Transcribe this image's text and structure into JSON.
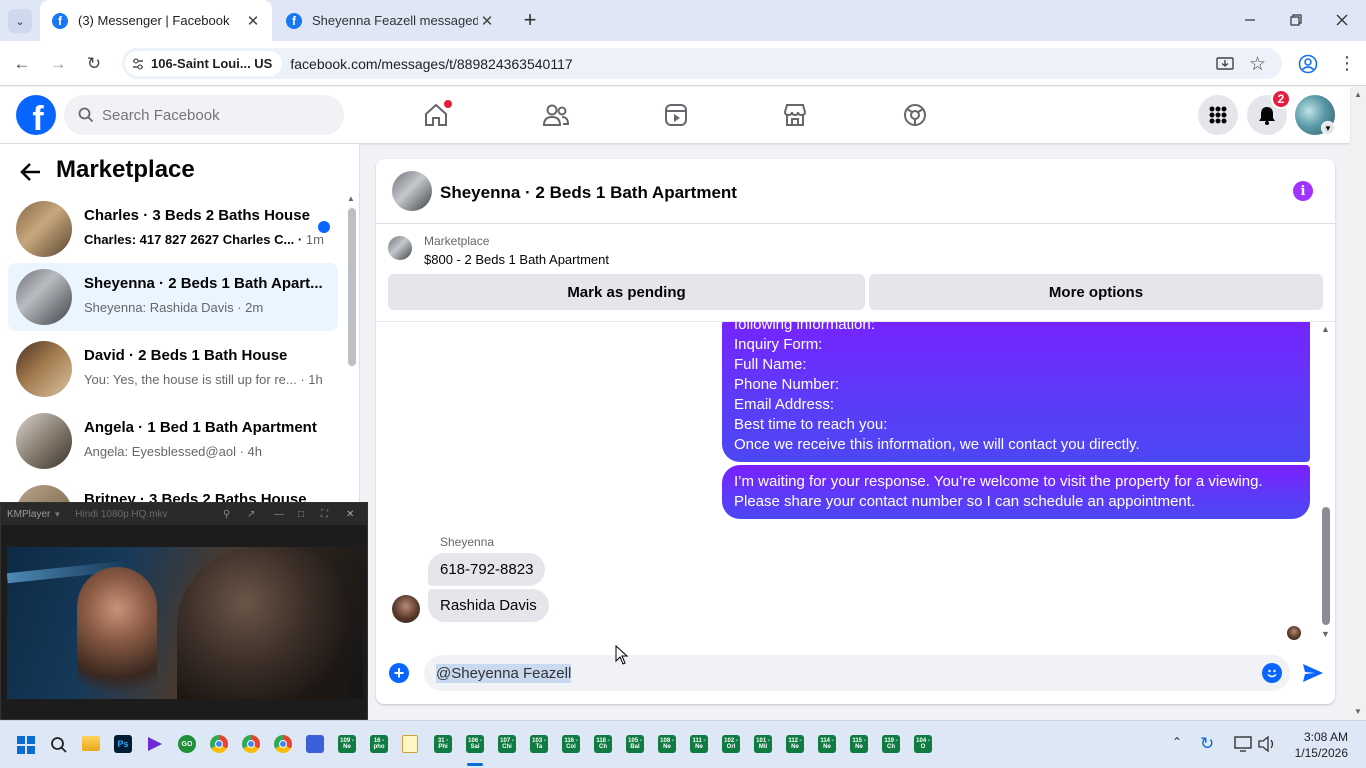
{
  "browser": {
    "tabs": [
      {
        "title": "(3) Messenger | Facebook",
        "active": true
      },
      {
        "title": "Sheyenna Feazell messaged Sheyenna",
        "active": false
      }
    ],
    "location_chip": "106-Saint Loui... US",
    "url": "facebook.com/messages/t/889824363540117"
  },
  "fb": {
    "search_placeholder": "Search Facebook",
    "notifications_badge": "2"
  },
  "sidebar": {
    "title": "Marketplace",
    "conversations": [
      {
        "name": "Charles · 3 Beds 2 Baths House",
        "preview": "Charles: 417 827 2627 Charles C...",
        "time": "1m",
        "unread": true
      },
      {
        "name": "Sheyenna · 2 Beds 1 Bath Apart...",
        "preview": "Sheyenna: Rashida Davis",
        "time": "2m",
        "selected": true
      },
      {
        "name": "David · 2 Beds 1 Bath House",
        "preview": "You: Yes, the house is still up for re...",
        "time": "1h"
      },
      {
        "name": "Angela · 1 Bed 1 Bath Apartment",
        "preview": "Angela: Eyesblessed@aol",
        "time": "4h"
      },
      {
        "name": "Britney · 3 Beds 2 Baths House",
        "preview": "",
        "time": ""
      }
    ]
  },
  "kmplayer": {
    "app_name": "KMPlayer",
    "file_title": "Hindi 1080p HQ.mkv"
  },
  "chat": {
    "title": "Sheyenna · 2 Beds 1 Bath Apartment",
    "listing_source": "Marketplace",
    "listing_price": "$800 - 2 Beds 1 Bath Apartment",
    "mark_pending": "Mark as pending",
    "more_options": "More options",
    "outgoing_1": [
      "following information:",
      "Inquiry Form:",
      "Full Name:",
      "Phone Number:",
      "Email Address:",
      "Best time to reach you:",
      "Once we receive this information, we will contact you directly."
    ],
    "outgoing_2": [
      "I’m waiting for your response. You’re welcome to visit the property for a viewing.",
      "Please share your contact number so I can schedule an appointment."
    ],
    "sender_name": "Sheyenna",
    "incoming": [
      "618-792-8823",
      "Rashida Davis"
    ],
    "composer_text": "@Sheyenna Feazell"
  },
  "taskbar": {
    "excel_labels": [
      "109 -Ne",
      "16 -pho",
      "31 -Phi",
      "106 -Sai",
      "107 -Chi",
      "103 -Ta",
      "116 -Col",
      "118 -Ch",
      "105 -Bal",
      "108 -Ne",
      "111 -Ne",
      "102 -Orl",
      "101 -Mil",
      "112 -Ne",
      "114 -Ne",
      "115 -Ne",
      "119 -Ch",
      "104 -O"
    ],
    "time": "3:08 AM",
    "date": "1/15/2026"
  }
}
